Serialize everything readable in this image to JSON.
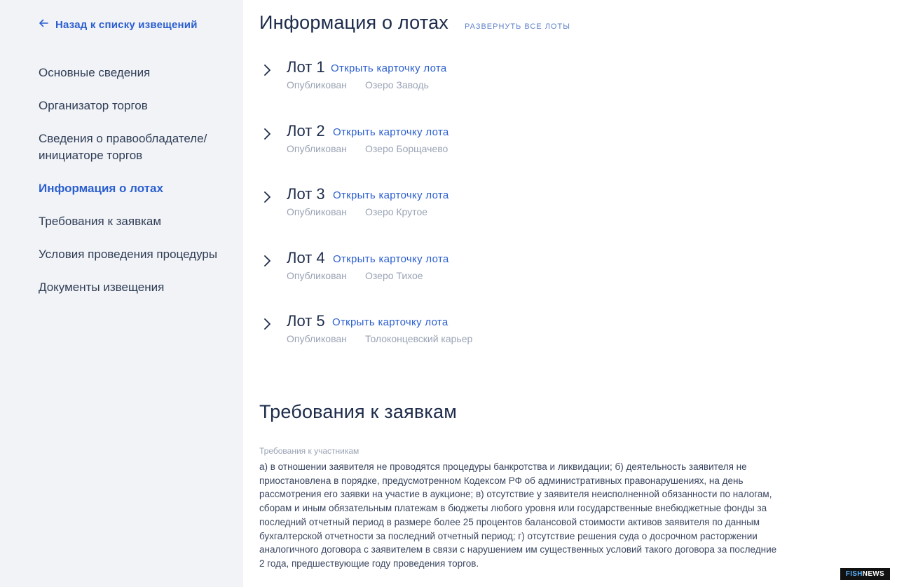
{
  "sidebar": {
    "back_label": "Назад к списку извещений",
    "items": [
      {
        "label": "Основные сведения",
        "active": false
      },
      {
        "label": "Организатор торгов",
        "active": false
      },
      {
        "label": "Сведения о правообладателе/ инициаторе торгов",
        "active": false
      },
      {
        "label": "Информация о лотах",
        "active": true
      },
      {
        "label": "Требования к заявкам",
        "active": false
      },
      {
        "label": "Условия проведения процедуры",
        "active": false
      },
      {
        "label": "Документы извещения",
        "active": false
      }
    ]
  },
  "lots_section": {
    "title": "Информация о лотах",
    "expand_all": "РАЗВЕРНУТЬ ВСЕ ЛОТЫ",
    "lots": [
      {
        "title": "Лот 1",
        "link": "Открыть карточку лота",
        "status": "Опубликован",
        "name": "Озеро Заводь"
      },
      {
        "title": "Лот 2",
        "link": "Открыть карточку лота",
        "status": "Опубликован",
        "name": "Озеро Борщачево"
      },
      {
        "title": "Лот 3",
        "link": "Открыть карточку лота",
        "status": "Опубликован",
        "name": "Озеро Крутое"
      },
      {
        "title": "Лот 4",
        "link": "Открыть карточку лота",
        "status": "Опубликован",
        "name": "Озеро Тихое"
      },
      {
        "title": "Лот 5",
        "link": "Открыть карточку лота",
        "status": "Опубликован",
        "name": "Толоконцевский карьер"
      }
    ]
  },
  "requirements_section": {
    "title": "Требования к заявкам",
    "label": "Требования к участникам",
    "text": "а) в отношении заявителя не проводятся процедуры банкротства и ликвидации; б) деятельность заявителя не приостановлена в порядке, предусмотренном Кодексом РФ об административных правонарушениях, на день рассмотрения его заявки на участие в аукционе; в) отсутствие у заявителя неисполненной обязанности по налогам, сборам и иным обязательным платежам в бюджеты любого уровня или государственные внебюджетные фонды за последний отчетный период в размере более 25 процентов балансовой стоимости активов заявителя по данным бухгалтерской отчетности за последний отчетный период; г) отсутствие решения суда о досрочном расторжении аналогичного договора с заявителем в связи с нарушением им существенных условий такого договора за последние 2 года, предшествующие году проведения торгов."
  },
  "watermark": {
    "part1": "FISH",
    "part2": "NEWS"
  },
  "icons": {
    "back": "arrow-left-icon",
    "expand": "chevron-right-icon"
  },
  "colors": {
    "accent": "#2b5fcf",
    "sidebar_bg": "#f1f3f7",
    "title": "#1c2b4a",
    "muted": "#9aa3b5"
  }
}
